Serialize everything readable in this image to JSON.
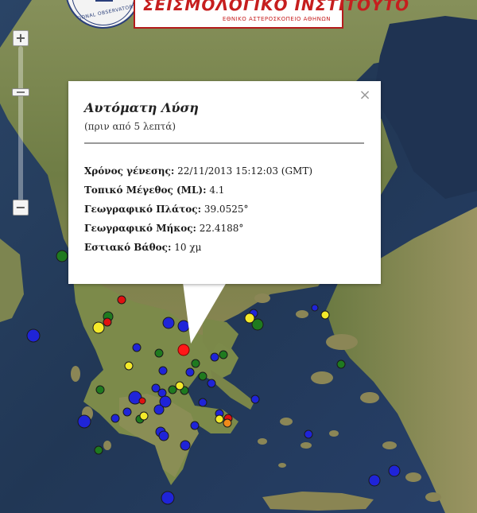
{
  "banner": {
    "seal_text": "NATIONAL OBSERVATORY",
    "title": "ΣΕΙΣΜΟΛΟΓΙΚΟ ΙΝΣΤΙΤΟΥΤΟ",
    "subtitle": "ΕΘΝΙΚΟ ΑΣΤΕΡΟΣΚΟΠΕΙΟ ΑΘΗΝΩΝ"
  },
  "zoom": {
    "in_label": "+",
    "out_label": "−",
    "level_fraction": 0.72
  },
  "info_window": {
    "close_label": "×",
    "title": "Αυτόματη Λύση",
    "subtitle": "(πριν από 5 λεπτά)",
    "fields": [
      {
        "label": "Χρόνος γένεσης:",
        "value": "22/11/2013  15:12:03 (GMT)"
      },
      {
        "label": "Τοπικό Μέγεθος (ML):",
        "value": "4.1"
      },
      {
        "label": "Γεωγραφικό Πλάτος:",
        "value": "39.0525°"
      },
      {
        "label": "Γεωγραφικό Μήκος:",
        "value": "22.4188°"
      },
      {
        "label": "Εστιακό Βάθος:",
        "value": "10 χμ"
      }
    ]
  },
  "colors": {
    "sea": "#2b3f5e",
    "land": "#7a8a4e",
    "marker_blue": "#1f24d8",
    "marker_green": "#1f7a1f",
    "marker_yellow": "#f4ea2a",
    "marker_red": "#e01010",
    "marker_orange": "#f08a1a"
  }
}
